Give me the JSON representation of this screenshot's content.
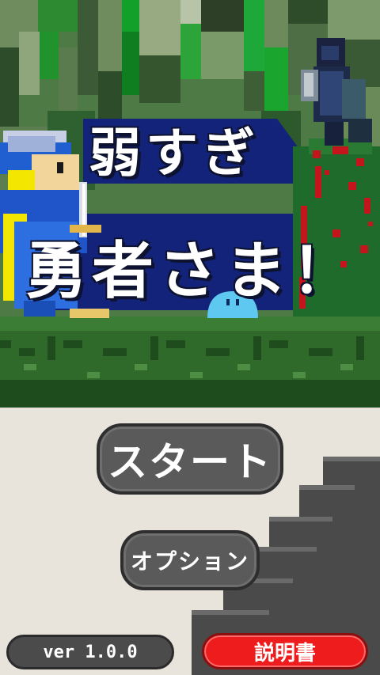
{
  "title": {
    "line1": "弱すぎ",
    "line2": "勇者さま！"
  },
  "menu": {
    "start_label": "スタート",
    "option_label": "オプション",
    "version_label": "ver 1.0.0",
    "manual_label": "説明書"
  },
  "colors": {
    "banner_blue": "#13237a",
    "title_text": "#ffffff",
    "start_button": "#5a5a5a",
    "manual_button": "#ee1c1c",
    "menu_background": "#e8e4dc",
    "stairs": "#4a4a4a"
  },
  "characters": [
    "hero-knight",
    "slime",
    "dark-knight-enemy"
  ]
}
